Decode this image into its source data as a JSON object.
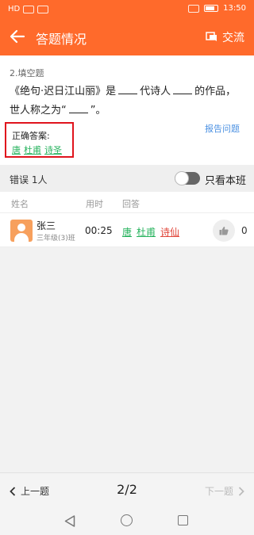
{
  "status_bar": {
    "left_text": "HD",
    "time": "13:50"
  },
  "app_bar": {
    "title": "答题情况",
    "exchange_label": "交流"
  },
  "question": {
    "type": "2.填空题",
    "text_part1": "《绝句·迟日江山丽》是",
    "text_part2": "代诗人",
    "text_part3": "的作品，世人称之为“",
    "text_part4": "”。",
    "correct_label": "正确答案:",
    "correct_answers": [
      "唐",
      "杜甫",
      "诗圣"
    ],
    "report_label": "报告问题"
  },
  "wrong_bar": {
    "label": "错误 1人",
    "toggle_label": "只看本班",
    "toggle_on": false
  },
  "list_header": {
    "name": "姓名",
    "time": "用时",
    "answer": "回答"
  },
  "students": [
    {
      "name": "张三",
      "class": "三年级(3)班",
      "time": "00:25",
      "answers": [
        {
          "text": "唐",
          "color": "#27b35e"
        },
        {
          "text": "杜甫",
          "color": "#27b35e"
        },
        {
          "text": "诗仙",
          "color": "#e0463a"
        }
      ],
      "likes": "0"
    }
  ],
  "bottom_bar": {
    "prev_label": "上一题",
    "pager": "2/2",
    "next_label": "下一题"
  },
  "colors": {
    "brand": "#ff6a2b",
    "correct": "#27b35e",
    "wrong": "#e0463a",
    "highlight_box": "#e0141d"
  },
  "icons": [
    "back-arrow-icon",
    "chat-icon",
    "thumbs-up-icon",
    "chevron-left-icon",
    "chevron-right-icon"
  ]
}
